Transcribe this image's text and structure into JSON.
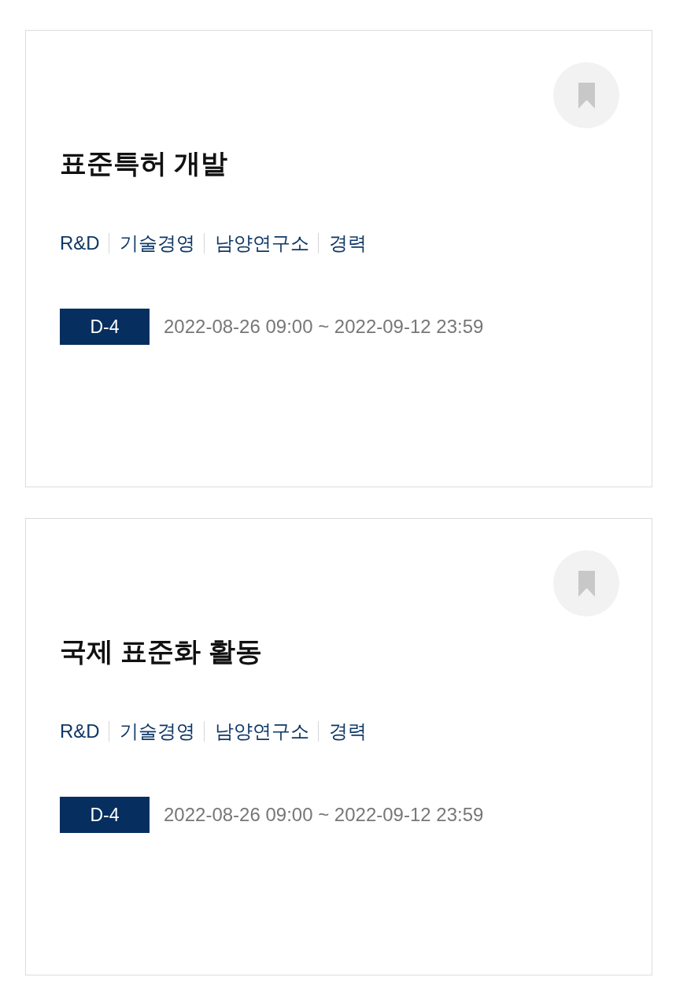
{
  "cards": [
    {
      "title": "표준특허 개발",
      "bookmarked": false,
      "tags": [
        "R&D",
        "기술경영",
        "남양연구소",
        "경력"
      ],
      "dday": "D-4",
      "period": "2022-08-26 09:00 ~ 2022-09-12 23:59"
    },
    {
      "title": "국제 표준화 활동",
      "bookmarked": false,
      "tags": [
        "R&D",
        "기술경영",
        "남양연구소",
        "경력"
      ],
      "dday": "D-4",
      "period": "2022-08-26 09:00 ~ 2022-09-12 23:59"
    }
  ]
}
